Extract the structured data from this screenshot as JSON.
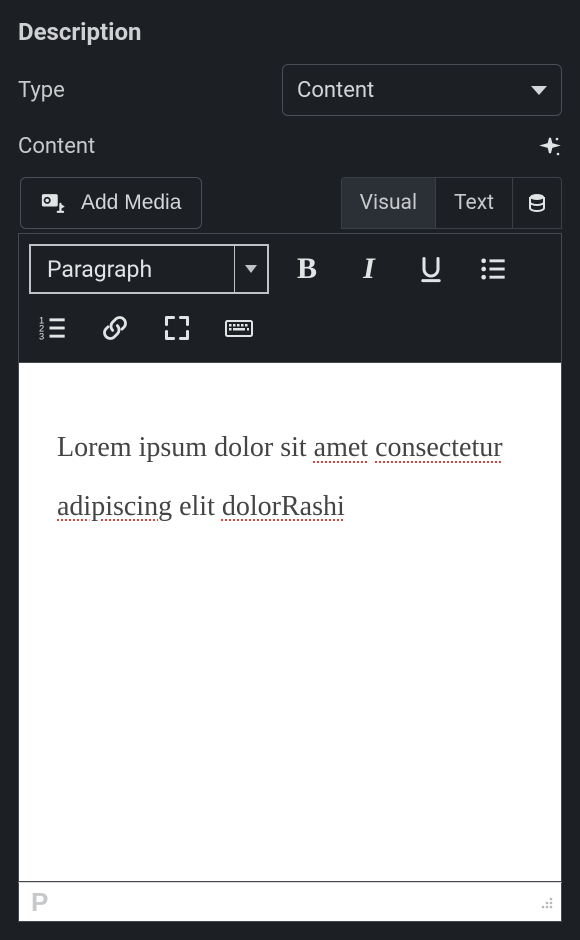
{
  "section": {
    "title": "Description"
  },
  "type_field": {
    "label": "Type",
    "value": "Content"
  },
  "content_field": {
    "label": "Content"
  },
  "editor": {
    "add_media_label": "Add Media",
    "tabs": {
      "visual": "Visual",
      "text": "Text"
    },
    "format_select": "Paragraph",
    "body": {
      "t1": "Lorem ipsum dolor sit ",
      "w1": "amet",
      "t2": " ",
      "w2": "consectetur",
      "t3": " ",
      "w3": "adipiscing",
      "t4": " elit ",
      "w4": "dolorRashi"
    },
    "status_path": "P"
  }
}
